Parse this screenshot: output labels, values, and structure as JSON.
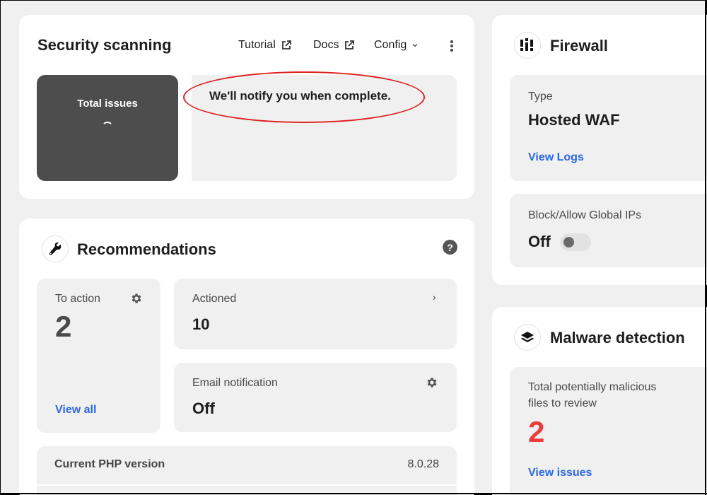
{
  "security_scanning": {
    "title": "Security scanning",
    "links": [
      {
        "label": "Tutorial",
        "icon": "external-link-icon"
      },
      {
        "label": "Docs",
        "icon": "external-link-icon"
      },
      {
        "label": "Config",
        "icon": "chevron-down-icon"
      }
    ],
    "more_icon": "kebab-menu-icon",
    "total_issues": {
      "label": "Total issues",
      "state": "loading"
    },
    "status_message": "We'll notify you when complete.",
    "annotation_color": "#e02020"
  },
  "recommendations": {
    "title": "Recommendations",
    "icon": "wrench-icon",
    "help_icon": "?",
    "to_action": {
      "label": "To action",
      "value": "2",
      "link": "View all"
    },
    "actioned": {
      "label": "Actioned",
      "value": "10",
      "chevron": "›"
    },
    "email_notification": {
      "label": "Email notification",
      "value": "Off"
    },
    "php_version": {
      "label": "Current PHP version",
      "value": "8.0.28"
    }
  },
  "firewall": {
    "title": "Firewall",
    "icon": "firewall-icon",
    "type": {
      "label": "Type",
      "value": "Hosted WAF",
      "link": "View Logs"
    },
    "global_ips": {
      "label": "Block/Allow Global IPs",
      "value": "Off",
      "toggle_on": false
    }
  },
  "malware_detection": {
    "title": "Malware detection",
    "icon": "layers-icon",
    "label_line1": "Total potentially malicious",
    "label_line2": "files to review",
    "value": "2",
    "value_color": "#ee3b3b",
    "link": "View issues"
  },
  "colors": {
    "link": "#2c67e6",
    "tile_bg": "#f0f0f0",
    "dark_tile": "#4d4d4d"
  }
}
